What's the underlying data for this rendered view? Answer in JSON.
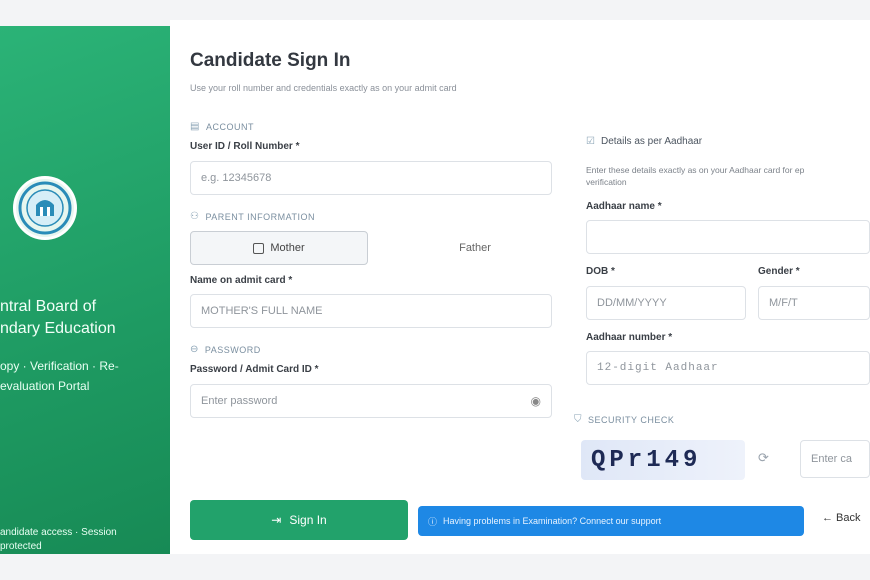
{
  "sidebar": {
    "org_line1": "ntral Board of",
    "org_line2": "ndary Education",
    "subtitle_line1": "opy · Verification · Re-",
    "subtitle_line2": "evaluation Portal",
    "footer_line1": "andidate access · Session",
    "footer_line2": "protected"
  },
  "form": {
    "title": "Candidate Sign In",
    "subtitle": "Use your roll number and credentials exactly as on your admit card",
    "account_section": "ACCOUNT",
    "userid_label": "User ID / Roll Number *",
    "userid_placeholder": "e.g. 12345678",
    "parent_section": "PARENT INFORMATION",
    "parent_options": [
      "Mother",
      "Father"
    ],
    "parent_name_label": "Name on admit card *",
    "parent_name_placeholder": "MOTHER'S FULL NAME",
    "password_section": "PASSWORD",
    "password_label": "Password / Admit Card ID *",
    "password_placeholder": "Enter password"
  },
  "aadhaar": {
    "section": "Details as per Aadhaar",
    "hint_line1": "Enter these details exactly as on your Aadhaar card for ep",
    "hint_line2": "verification",
    "name_label": "Aadhaar name *",
    "dob_label": "DOB *",
    "dob_placeholder": "DD/MM/YYYY",
    "gender_label": "Gender *",
    "gender_placeholder": "M/F/T",
    "number_label": "Aadhaar number *",
    "number_placeholder": "12-digit Aadhaar"
  },
  "security": {
    "section": "SECURITY CHECK",
    "captcha": "QPr149",
    "captcha_placeholder": "Enter ca"
  },
  "actions": {
    "sign_in": "Sign In",
    "help": "Having problems in Examination? Connect our support",
    "back": "← Back"
  }
}
